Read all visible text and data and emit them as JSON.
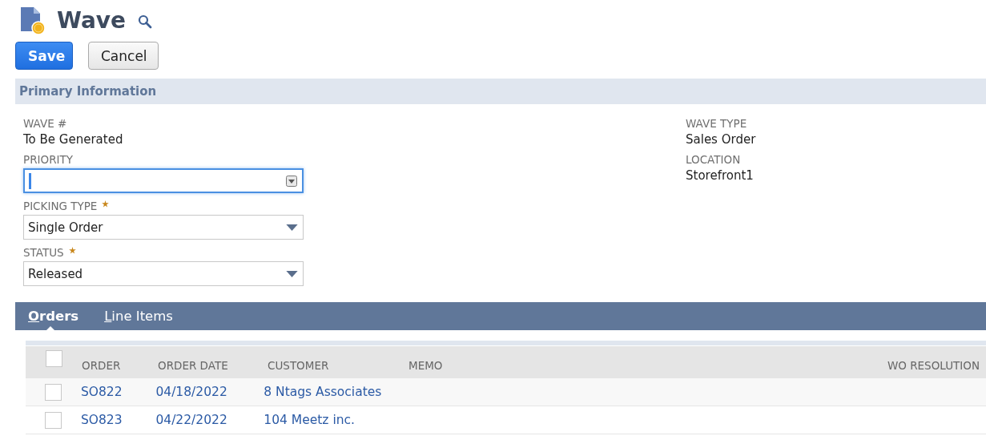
{
  "page": {
    "title": "Wave"
  },
  "buttons": [
    {
      "label": "Save",
      "kind": "primary"
    },
    {
      "label": "Cancel",
      "kind": "secondary"
    }
  ],
  "section": {
    "title": "Primary Information"
  },
  "left_fields": [
    {
      "label": "WAVE #",
      "kind": "display",
      "value": "To Be Generated",
      "required": false
    },
    {
      "label": "PRIORITY",
      "kind": "input",
      "required": false,
      "focused": true
    },
    {
      "label": "PICKING TYPE",
      "kind": "select",
      "value": "Single Order",
      "required": true,
      "focused": false
    },
    {
      "label": "STATUS",
      "kind": "select",
      "value": "Released",
      "required": true,
      "focused": false
    }
  ],
  "right_fields": [
    {
      "label": "WAVE TYPE",
      "kind": "display",
      "value": "Sales Order",
      "required": false
    },
    {
      "label": "LOCATION",
      "kind": "display",
      "value": "Storefront1",
      "required": false
    }
  ],
  "tabs": [
    {
      "label": "Orders",
      "selected": true
    },
    {
      "label": "Line Items",
      "selected": false
    }
  ],
  "table": {
    "all_checked": false,
    "columns": [
      "ORDER",
      "ORDER DATE",
      "CUSTOMER",
      "MEMO",
      "WO RESOLUTION"
    ],
    "rows": [
      {
        "checked": false,
        "cells": [
          "SO822",
          "04/18/2022",
          "8 Ntags Associates",
          "",
          ""
        ]
      },
      {
        "checked": false,
        "cells": [
          "SO823",
          "04/22/2022",
          "104 Meetz inc.",
          "",
          ""
        ]
      }
    ]
  }
}
